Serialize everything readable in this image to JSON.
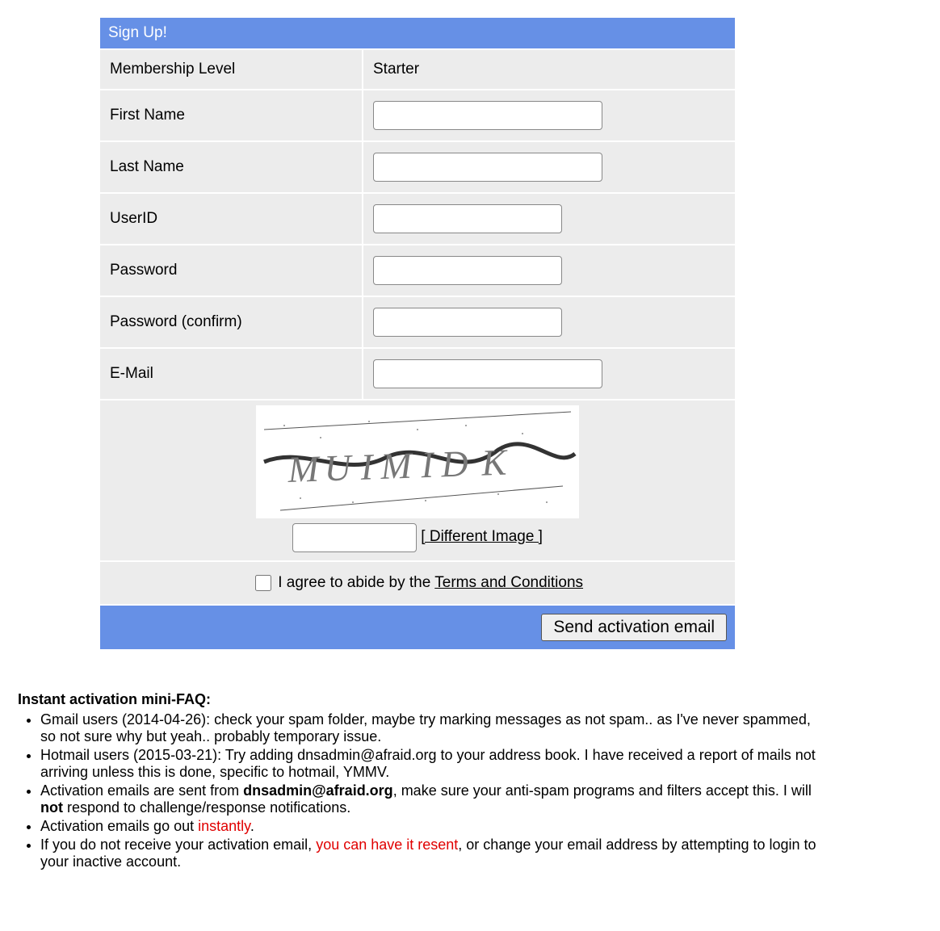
{
  "form": {
    "title": "Sign Up!",
    "fields": {
      "membership": {
        "label": "Membership Level",
        "value": "Starter"
      },
      "first_name": {
        "label": "First Name"
      },
      "last_name": {
        "label": "Last Name"
      },
      "userid": {
        "label": "UserID"
      },
      "password": {
        "label": "Password"
      },
      "password_confirm": {
        "label": "Password (confirm)"
      },
      "email": {
        "label": "E-Mail"
      }
    },
    "captcha": {
      "different_image": "[ Different Image ]"
    },
    "agree": {
      "text_prefix": "I agree to abide by the ",
      "link_text": "Terms and Conditions"
    },
    "submit_label": "Send activation email"
  },
  "faq": {
    "heading": "Instant activation mini-FAQ:",
    "items": {
      "gmail": "Gmail users (2014-04-26): check your spam folder, maybe try marking messages as not spam.. as I've never spammed, so not sure why but yeah.. probably temporary issue.",
      "hotmail": "Hotmail users (2015-03-21): Try adding dnsadmin@afraid.org to your address book. I have received a report of mails not arriving unless this is done, specific to hotmail, YMMV.",
      "from_a": "Activation emails are sent from ",
      "from_addr": "dnsadmin@afraid.org",
      "from_b": ", make sure your anti-spam programs and filters accept this. I will ",
      "from_not": "not",
      "from_c": " respond to challenge/response notifications.",
      "instant_a": "Activation emails go out ",
      "instant_red": "instantly",
      "instant_b": ".",
      "resend_a": " If you do not receive your activation email, ",
      "resend_red": "you can have it resent",
      "resend_b": ", or change your email address by attempting to login to your inactive account."
    }
  }
}
